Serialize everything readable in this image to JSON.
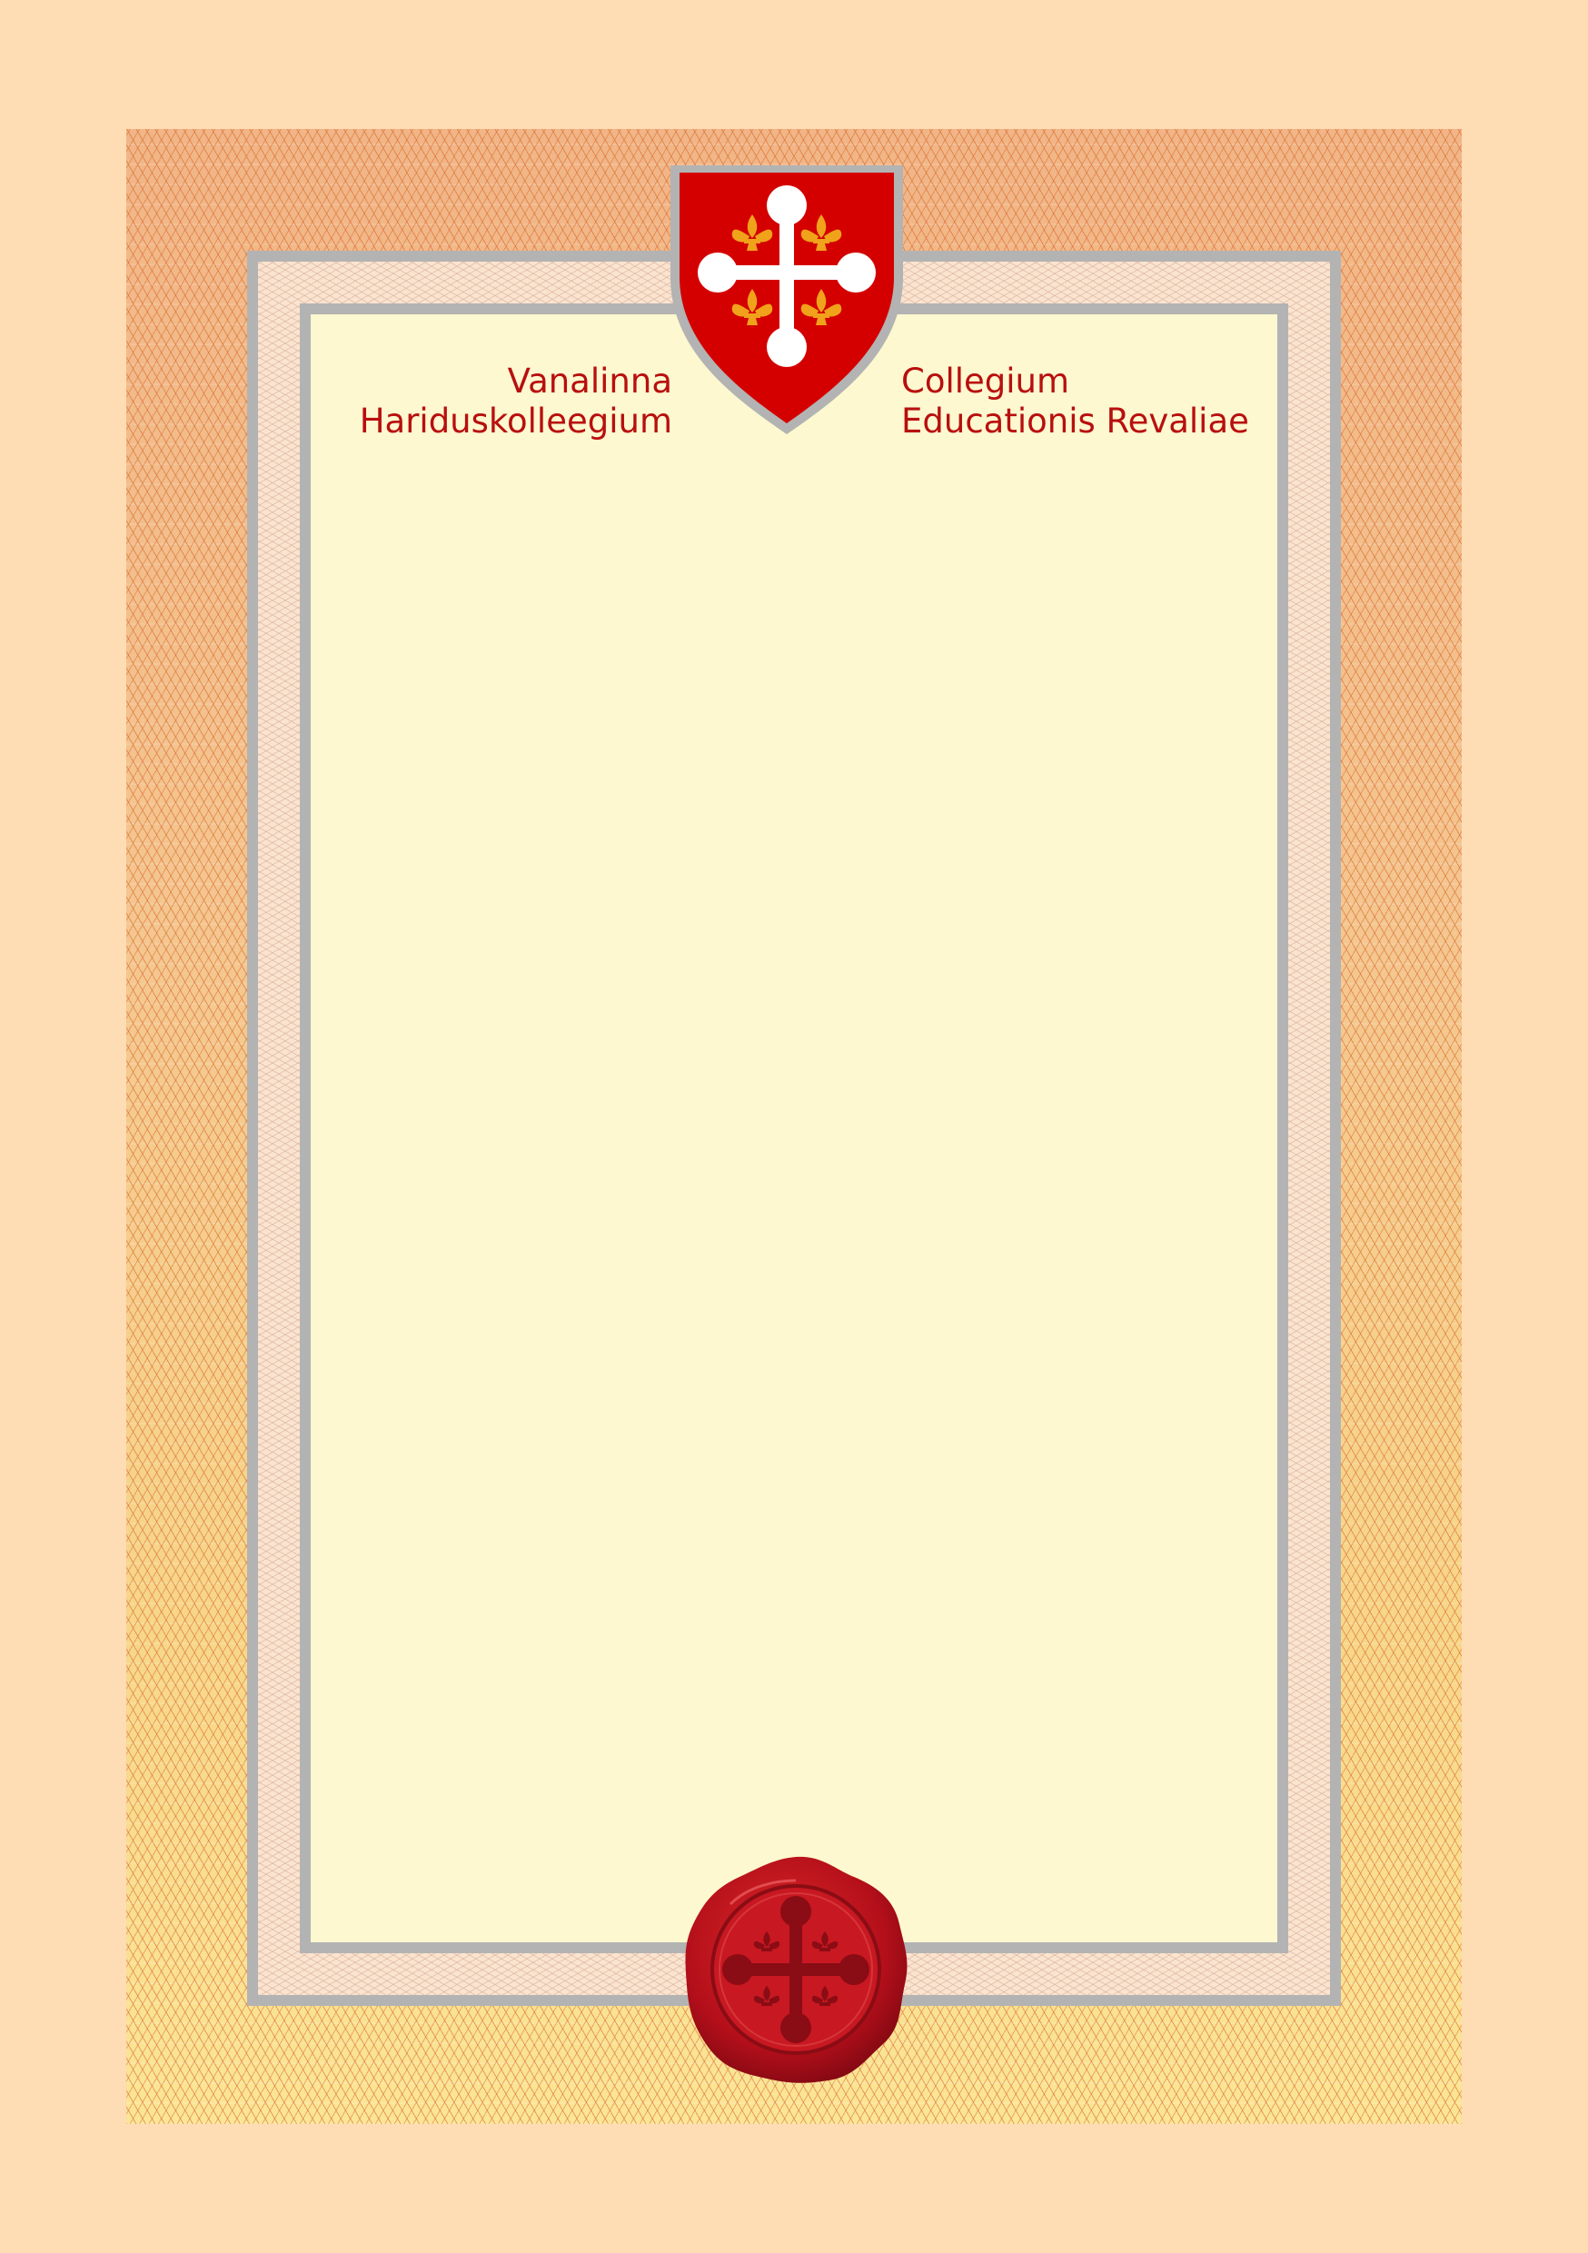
{
  "certificate": {
    "school_name_estonian": {
      "line1": "Vanalinna",
      "line2": "Hariduskolleegium"
    },
    "school_name_latin": {
      "line1": "Collegium",
      "line2": "Educationis Revaliae"
    },
    "body_text": ""
  },
  "colors": {
    "background": "#fedcb4",
    "text_red": "#b80f0f",
    "frame_silver": "#b3b3b3",
    "paper": "#fdf8cf",
    "crest_red": "#cc0000",
    "fleur_orange": "#f0a21a",
    "wax_red": "#c1121f"
  },
  "icons": {
    "crest": "coat-of-arms-cross-icon",
    "seal": "wax-seal-icon"
  }
}
